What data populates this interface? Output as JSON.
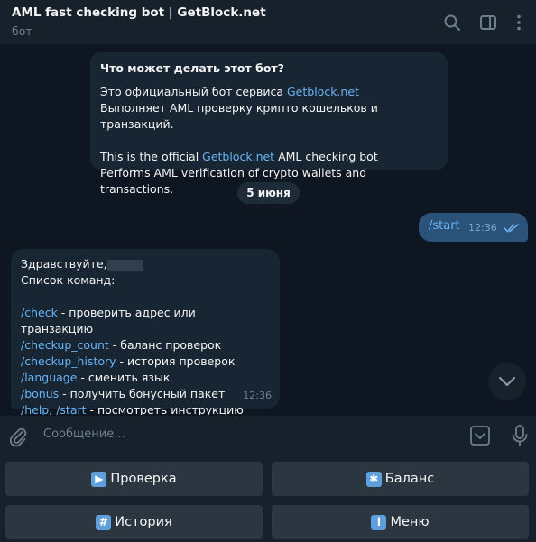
{
  "header": {
    "title": "AML fast checking bot | GetBlock.net",
    "subtitle": "бот"
  },
  "info_card": {
    "title": "Что может делать этот бот?",
    "ru_line1_prefix": "Это официальный бот сервиса ",
    "ru_line1_link": "Getblock.net",
    "ru_line2": "Выполняет AML проверку крипто кошельков и транзакций.",
    "en_line1_prefix": "This is the official ",
    "en_line1_link": "Getblock.net",
    "en_line1_suffix": " AML checking bot",
    "en_line2": "Performs AML verification of crypto wallets and transactions."
  },
  "date_separator": "5 июня",
  "outgoing_message": {
    "text": "/start",
    "time": "12:36"
  },
  "incoming_message": {
    "greeting": "Здравствуйте,",
    "commands_title": "Список команд:",
    "commands": [
      {
        "cmd": "/check",
        "desc": " - проверить адрес или транзакцию"
      },
      {
        "cmd": "/checkup_count",
        "desc": " - баланс проверок"
      },
      {
        "cmd": "/checkup_history",
        "desc": " - история проверок"
      },
      {
        "cmd": "/language",
        "desc": " - сменить язык"
      },
      {
        "cmd": "/bonus",
        "desc": " - получить бонусный пакет"
      }
    ],
    "last_cmd_a": "/help",
    "last_sep": ", ",
    "last_cmd_b": "/start",
    "last_desc": " - посмотреть инструкцию",
    "time": "12:36"
  },
  "composer": {
    "placeholder": "Сообщение..."
  },
  "keyboard": {
    "buttons": [
      {
        "icon": "▶",
        "label": "Проверка"
      },
      {
        "icon": "✱",
        "label": "Баланс"
      },
      {
        "icon": "#",
        "label": "История"
      },
      {
        "icon": "i",
        "label": "Меню"
      }
    ]
  },
  "icons": {
    "header": [
      "search-icon",
      "sidebar-toggle-icon",
      "more-vertical-icon"
    ],
    "composer": [
      "attach-icon",
      "bot-keyboard-icon",
      "microphone-icon"
    ],
    "read_status": "double-check-icon",
    "scroll": "chevron-down-icon"
  },
  "colors": {
    "background": "#0e1621",
    "panel": "#17212b",
    "incoming_bubble": "#182533",
    "outgoing_bubble": "#2b5278",
    "link": "#6ab3f3",
    "muted": "#6d7f8f",
    "keyboard_button": "#2b3640"
  }
}
